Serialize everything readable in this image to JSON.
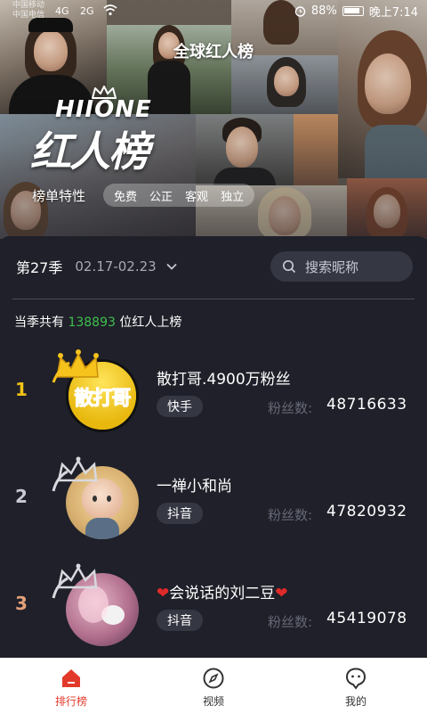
{
  "status_bar": {
    "carrier1": "中国移动",
    "carrier2": "中国电信",
    "net1": "4G",
    "net2": "2G",
    "battery": "88%",
    "time": "晚上7:14"
  },
  "hero": {
    "title": "全球红人榜",
    "logo_brand": "HIIONE",
    "logo_main": "红人榜",
    "features_label": "榜单特性",
    "features": [
      "免费",
      "公正",
      "客观",
      "独立"
    ]
  },
  "season": {
    "label": "第27季",
    "dates": "02.17-02.23"
  },
  "search": {
    "placeholder": "搜索昵称"
  },
  "summary": {
    "prefix": "当季共有",
    "count": "138893",
    "suffix": "位红人上榜"
  },
  "rankings": [
    {
      "rank": "1",
      "name": "散打哥.4900万粉丝",
      "platform": "快手",
      "fans_label": "粉丝数:",
      "fans": "48716633",
      "avatar_text": "散打哥",
      "rank_color": "#f2c317"
    },
    {
      "rank": "2",
      "name": "一禅小和尚",
      "platform": "抖音",
      "fans_label": "粉丝数:",
      "fans": "47820932",
      "rank_color": "#c9cbd3"
    },
    {
      "rank": "3",
      "name": "会说话的刘二豆",
      "name_heart": "❤",
      "platform": "抖音",
      "fans_label": "粉丝数:",
      "fans": "45419078",
      "rank_color": "#e3a07a"
    }
  ],
  "tabbar": [
    {
      "label": "排行榜",
      "icon": "home-icon",
      "active": true
    },
    {
      "label": "视频",
      "icon": "compass-icon",
      "active": false
    },
    {
      "label": "我的",
      "icon": "chat-face-icon",
      "active": false
    }
  ],
  "colors": {
    "accent_red": "#e23a2a",
    "count_green": "#3fbf4e",
    "panel_bg": "#1f2029"
  }
}
